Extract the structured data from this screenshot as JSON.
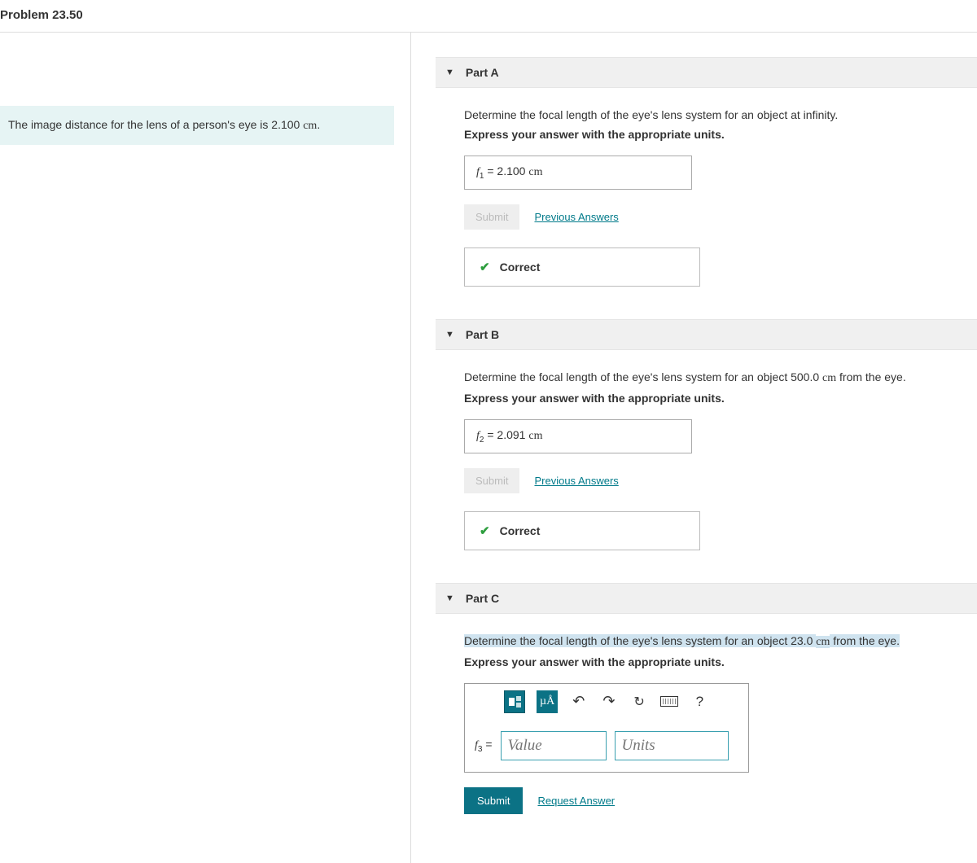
{
  "header": {
    "title": "Problem 23.50"
  },
  "problem": {
    "statement_prefix": "The image distance for the lens of a person's eye is 2.100 ",
    "statement_unit": "cm",
    "statement_suffix": "."
  },
  "labels": {
    "submit": "Submit",
    "previous_answers": "Previous Answers",
    "request_answer": "Request Answer",
    "correct": "Correct",
    "value_placeholder": "Value",
    "units_placeholder": "Units",
    "hint": "Express your answer with the appropriate units."
  },
  "parts": {
    "a": {
      "label": "Part A",
      "prompt": "Determine the focal length of the eye's lens system for an object at infinity.",
      "var": "f",
      "sub": "1",
      "value": "2.100",
      "unit": "cm"
    },
    "b": {
      "label": "Part B",
      "prompt_pre": "Determine the focal length of the eye's lens system for an object 500.0 ",
      "prompt_unit": "cm",
      "prompt_post": " from the eye.",
      "var": "f",
      "sub": "2",
      "value": "2.091",
      "unit": "cm"
    },
    "c": {
      "label": "Part C",
      "prompt_pre": "Determine the focal length of the eye's lens system for an object 23.0 ",
      "prompt_unit": "cm",
      "prompt_post": " from the eye.",
      "var": "f",
      "sub": "3"
    }
  },
  "toolbar": {
    "muA": "µÅ",
    "help": "?"
  }
}
